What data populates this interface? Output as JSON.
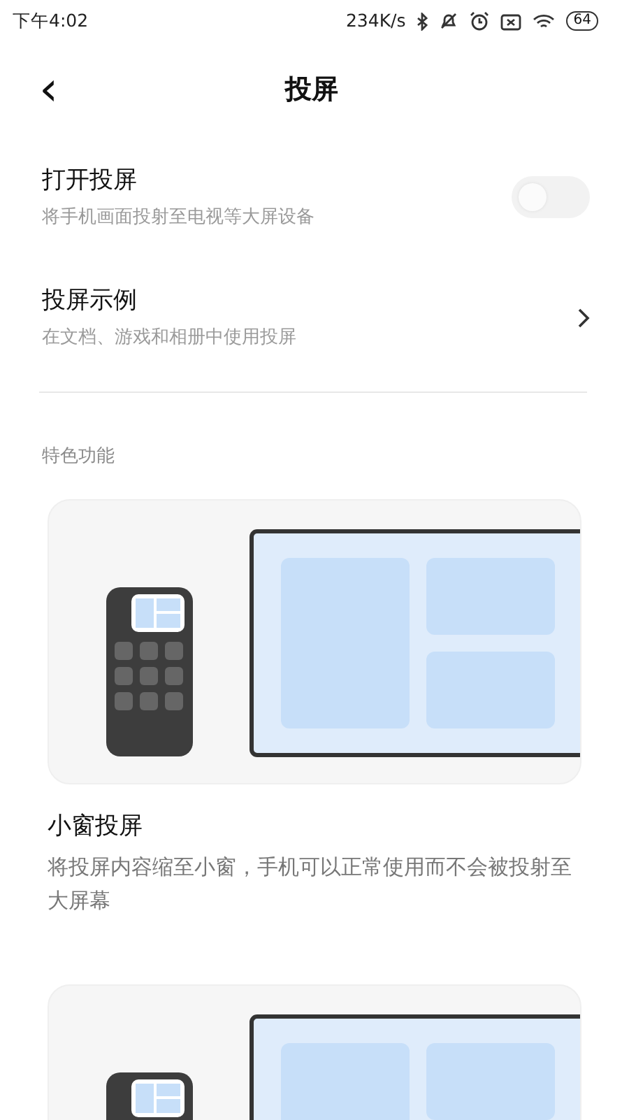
{
  "status_bar": {
    "time": "下午4:02",
    "net_speed": "234K/s",
    "battery": "64"
  },
  "header": {
    "back": "‹",
    "title": "投屏"
  },
  "settings": [
    {
      "kind": "toggle",
      "title": "打开投屏",
      "subtitle": "将手机画面投射至电视等大屏设备",
      "on": false
    },
    {
      "kind": "link",
      "title": "投屏示例",
      "subtitle": "在文档、游戏和相册中使用投屏"
    }
  ],
  "section_label": "特色功能",
  "features": [
    {
      "kind": "illustration",
      "title": "小窗投屏",
      "description": "将投屏内容缩至小窗，手机可以正常使用而不会被投射至大屏幕"
    },
    {
      "kind": "illustration"
    }
  ]
}
